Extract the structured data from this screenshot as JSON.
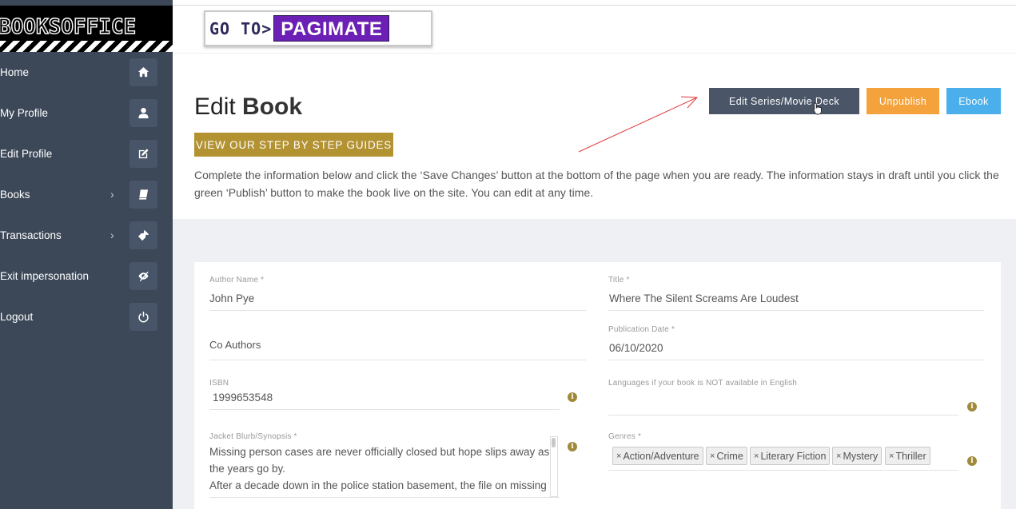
{
  "sidebar": {
    "logo_text": "BOOKSOFFICE",
    "items": [
      {
        "label": "Home",
        "icon": "home-icon",
        "has_chevron": false
      },
      {
        "label": "My Profile",
        "icon": "user-icon",
        "has_chevron": false
      },
      {
        "label": "Edit Profile",
        "icon": "edit-icon",
        "has_chevron": false
      },
      {
        "label": "Books",
        "icon": "book-icon",
        "has_chevron": true
      },
      {
        "label": "Transactions",
        "icon": "ticket-icon",
        "has_chevron": true
      },
      {
        "label": "Exit impersonation",
        "icon": "eye-slash-icon",
        "has_chevron": false
      },
      {
        "label": "Logout",
        "icon": "power-icon",
        "has_chevron": false
      }
    ],
    "chevron": "›"
  },
  "brand": {
    "goto": "GO TO>",
    "name": "PAGIMATE"
  },
  "header": {
    "title_part1": "Edit",
    "title_part2": " Book",
    "guide_button": "VIEW OUR STEP BY STEP GUIDES",
    "intro": "Complete the information below and click the ‘Save Changes’ button at the bottom of the page when you are ready. The information stays in draft until you click the green ‘Publish’ button to make the book live on the site. You can edit at any time.",
    "buttons": {
      "series": "Edit Series/Movie Deck",
      "unpublish": "Unpublish",
      "ebook": "Ebook"
    }
  },
  "form": {
    "author_name": {
      "label": "Author Name *",
      "value": "John Pye"
    },
    "title": {
      "label": "Title *",
      "value": "Where The Silent Screams Are Loudest"
    },
    "publication_date": {
      "label": "Publication Date *",
      "value": "06/10/2020"
    },
    "co_authors": {
      "placeholder": "Co Authors"
    },
    "isbn": {
      "label": "ISBN",
      "value": "1999653548"
    },
    "languages": {
      "label": "Languages if your book is NOT available in English",
      "value": ""
    },
    "blurb": {
      "label": "Jacket Blurb/Synopsis *",
      "lines": [
        "Missing person cases are never officially closed but hope slips away as",
        "the years go by.",
        "After a decade down in the police station basement, the file on missing"
      ]
    },
    "genres": {
      "label": "Genres *",
      "tags": [
        "Action/Adventure",
        "Crime",
        "Literary Fiction",
        "Mystery",
        "Thriller"
      ]
    },
    "info_glyph": "i",
    "tag_remove": "×"
  },
  "colors": {
    "sidebar_bg": "#3c4858",
    "guide_gold": "#b39232",
    "unpublish_orange": "#f4a23c",
    "ebook_blue": "#4aafea",
    "series_slate": "#4a5668",
    "brand_purple": "#6c1fb4"
  }
}
